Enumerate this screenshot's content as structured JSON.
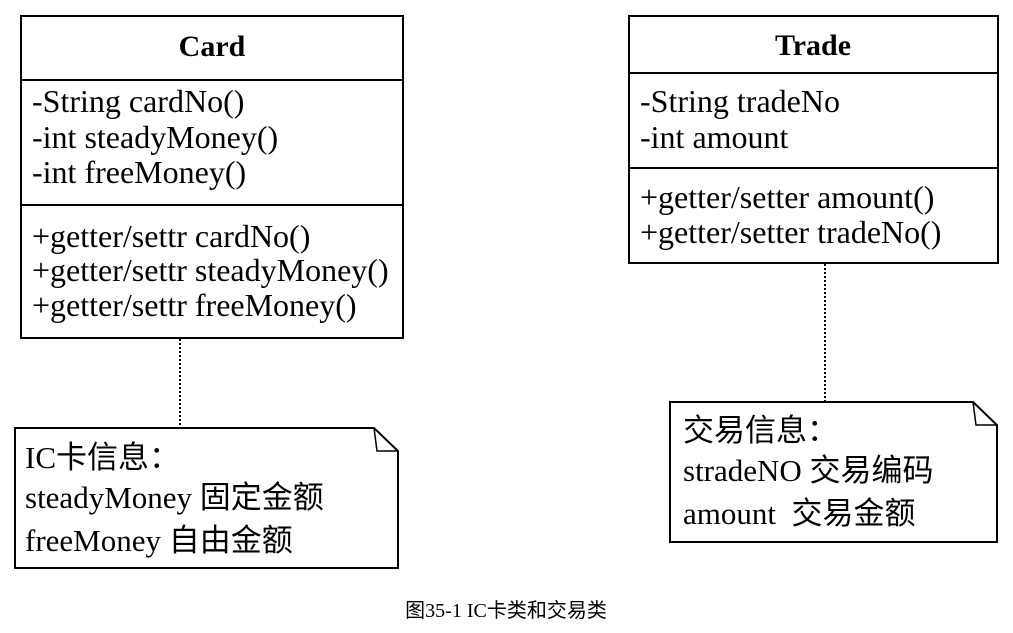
{
  "classes": [
    {
      "name": "Card",
      "attributes": [
        "-String cardNo()",
        "-int steadyMoney()",
        "-int freeMoney()"
      ],
      "methods": [
        "+getter/settr cardNo()",
        "+getter/settr steadyMoney()",
        "+getter/settr freeMoney()"
      ]
    },
    {
      "name": "Trade",
      "attributes": [
        "-String tradeNo",
        "-int amount"
      ],
      "methods": [
        "+getter/setter amount()",
        "+getter/setter tradeNo()"
      ]
    }
  ],
  "notes": [
    {
      "lines": [
        "IC卡信息：",
        "steadyMoney 固定金额",
        "freeMoney 自由金额"
      ]
    },
    {
      "lines": [
        "交易信息：",
        "stradeNO 交易编码",
        "amount  交易金额"
      ]
    }
  ],
  "caption": "图35-1 IC卡类和交易类"
}
